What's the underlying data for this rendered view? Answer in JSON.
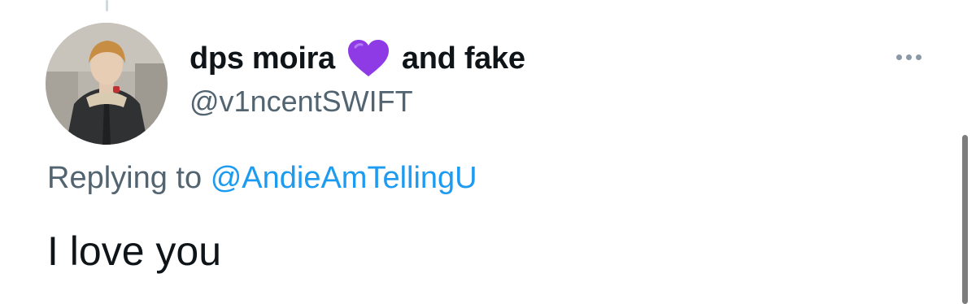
{
  "tweet": {
    "display_name_part1": "dps moira",
    "display_name_emoji": "purple-heart-icon",
    "display_name_part2": "and fake",
    "handle": "@v1ncentSWIFT",
    "replying_prefix": "Replying to",
    "replying_mention": "@AndieAmTellingU",
    "text": "I love you"
  },
  "avatar": {
    "icon": "avatar-photo"
  },
  "more": {
    "icon": "more-dots-icon"
  },
  "colors": {
    "text_primary": "#0f1419",
    "text_secondary": "#536471",
    "link": "#1d9bf0",
    "heart": "#8e3be6"
  }
}
